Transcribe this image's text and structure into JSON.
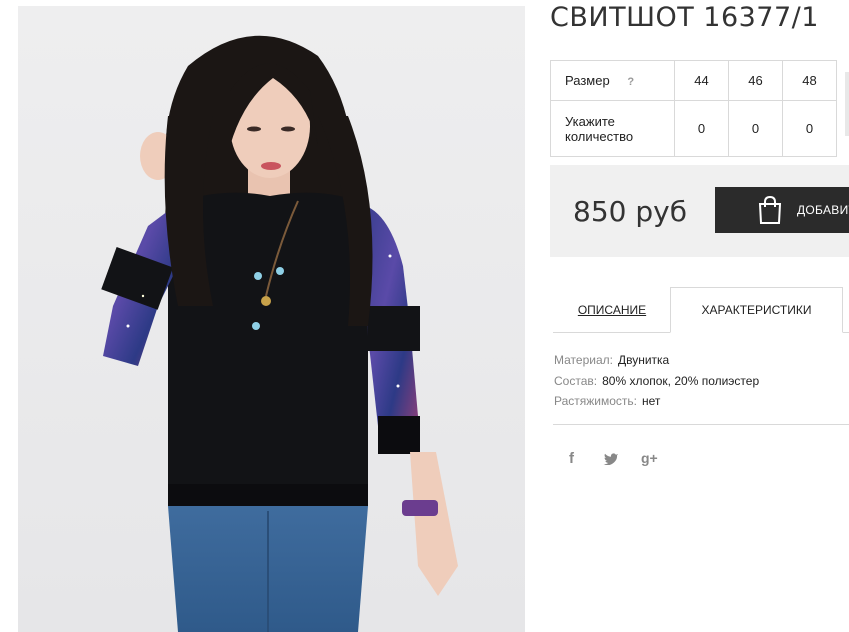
{
  "product": {
    "title": "СВИТШОТ 16377/1",
    "image_alt": "Модель в черном свитшоте с космическими рукавами"
  },
  "size_table": {
    "size_label": "Размер",
    "help_label": "?",
    "sizes": [
      "44",
      "46",
      "48"
    ],
    "quantity_label": "Укажите количество",
    "quantities": [
      "0",
      "0",
      "0"
    ]
  },
  "purchase": {
    "price": "850 руб",
    "add_button": "ДОБАВИТЬ",
    "cart_icon": "shopping-bag-icon"
  },
  "tabs": [
    {
      "label": "ОПИСАНИЕ",
      "active": false
    },
    {
      "label": "ХАРАКТЕРИСТИКИ",
      "active": true
    }
  ],
  "specs": [
    {
      "key": "Материал:",
      "value": "Двунитка"
    },
    {
      "key": "Состав:",
      "value": "80% хлопок, 20% полиэстер"
    },
    {
      "key": "Растяжимость:",
      "value": "нет"
    }
  ],
  "social": {
    "facebook": "f",
    "twitter_icon": "twitter-icon",
    "google_plus": "g+"
  },
  "colors": {
    "button_bg": "#2b2b2b",
    "price_box_bg": "#f0f0f0",
    "border": "#d9d9d9"
  }
}
